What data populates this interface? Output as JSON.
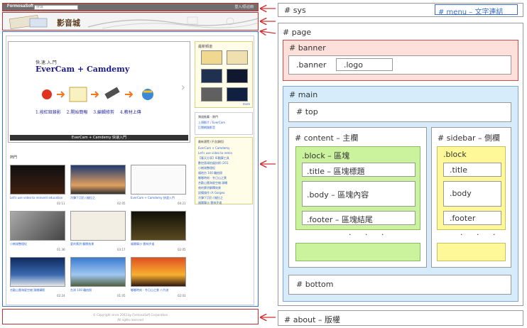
{
  "screenshot": {
    "sys": {
      "logo": "FormosaSoft",
      "search_placeholder": "搜尋",
      "right_link": "登入/原註冊"
    },
    "banner": {
      "logo": "影音城"
    },
    "slide": {
      "small_title": "快.速.入.門",
      "title": "EverCam + Camdemy",
      "steps": "1.按紅鈕錄影 2.開始簡報 3.編輯修剪 4.教材上傳",
      "caption": "EverCam + Camdemy 快速入門"
    },
    "side1": {
      "title": "最新頻道",
      "more": "more"
    },
    "side2": {
      "title": "頻道推薦 - 熱門",
      "lines": [
        "上傳影片 / EverCam",
        "訂閱網路影音"
      ]
    },
    "side3": {
      "title": "最新瀏覽 (不含課程)",
      "lines": [
        "EverCam + Camdemy",
        "Let's use video to remin",
        "【春天分享】IE翻譯工具",
        "數控直球拍展技術 (201",
        "小樹湖整理紀",
        "福地台 100 輪拍照",
        "嘟嘟時刻 - 冬日山之景",
        "合歡山雲海星空縮 頭嘟",
        "夜的夢詩解釋效果",
        "設備操作 (A Gorgeo",
        "冷鋒下沉仍 (福拉之",
        "福爾摩沙 雲林步道"
      ]
    },
    "hot": {
      "label": "熱門",
      "videos": [
        {
          "caption": "Let's use video to reinvent education",
          "time": "02:11"
        },
        {
          "caption": "冷鋒下沉仍 (福拉之",
          "time": "02:05"
        },
        {
          "caption": "EverCam + Camdemy 快速入門",
          "time": "04:21"
        },
        {
          "caption": "小樹湖整理紀",
          "time": "01:36"
        },
        {
          "caption": "愛的素詩 翻閱效果",
          "time": "03:17"
        },
        {
          "caption": "福爾摩沙 雲林步道",
          "time": "02:05"
        },
        {
          "caption": "合歡山雲海星空縮 頭嘟攝影",
          "time": "02:24"
        },
        {
          "caption": "台灣 100 輪拍照",
          "time": "01:05"
        },
        {
          "caption": "嘟嘟時刻 - 冬日山之景 八竹流",
          "time": "02:03"
        }
      ]
    },
    "about": {
      "line1": "© Copyright since 2003 by FormosaSoft Corporation",
      "line2": "All rights reserved"
    }
  },
  "diagram": {
    "sys": "# sys",
    "menu": "# menu – 文字連結",
    "page": "# page",
    "banner": "# banner",
    "banner_class": ".banner",
    "logo_class": ".logo",
    "main": "# main",
    "top": "# top",
    "content": "# content – 主欄",
    "sidebar": "# sidebar – 側欄",
    "block": ".block – 區塊",
    "title": ".title – 區塊標題",
    "body": ".body – 區塊內容",
    "footer": ".footer – 區塊結尾",
    "s_block": ".block",
    "s_title": ".title",
    "s_body": ".body",
    "s_footer": ".footer",
    "dots": "· · ·",
    "bottom": "# bottom",
    "about": "# about – 版權"
  },
  "colors": {
    "arrow": "#d03030",
    "banner_fill": "#fde0da",
    "main_fill": "#d6ecfa",
    "block_fill": "#cbf29d",
    "sidebar_block_fill": "#fff898",
    "menu_border": "#3a6fc9"
  }
}
